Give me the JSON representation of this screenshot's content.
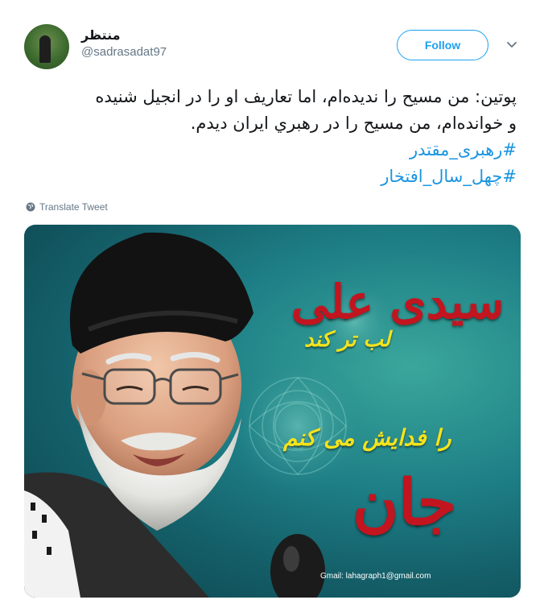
{
  "user": {
    "display_name": "منتظر",
    "handle": "@sadrasadat97"
  },
  "follow_label": "Follow",
  "tweet": {
    "line1": "پوتین: من مسیح را ندیده‌ام، اما تعاریف او را در انجیل شنیده",
    "line2": "و خوانده‌ام، من مسیح را در رهبري ایران دیدم.",
    "hashtag1": "#رهبری_مقتدر",
    "hashtag2": "#چهل_سال_افتخار"
  },
  "translate_label": "Translate Tweet",
  "media": {
    "calligraphy_line1": "سیدی علی",
    "calligraphy_line2": "لب تر کند",
    "calligraphy_line3": "جان",
    "calligraphy_line4": "را فدایش می کنم",
    "gmail_text": "Gmail: lahagraph1@gmail.com"
  },
  "colors": {
    "accent": "#1da1f2",
    "hashtag": "#1b95e0",
    "secondary_text": "#657786"
  }
}
